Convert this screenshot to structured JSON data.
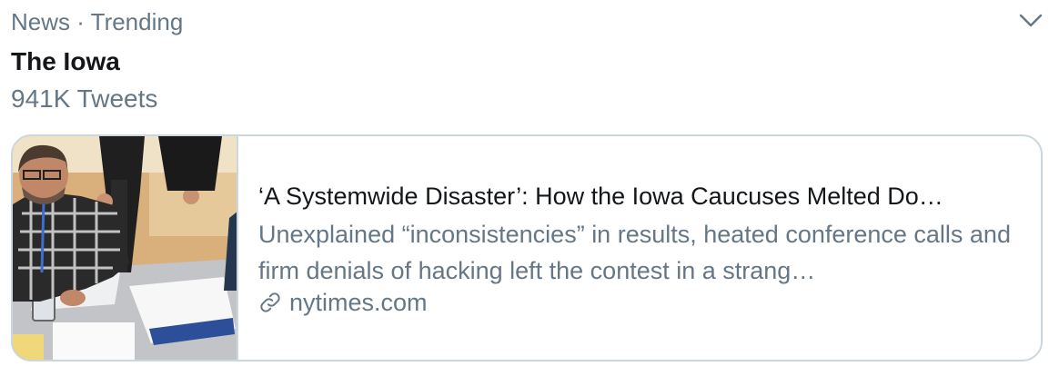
{
  "trend": {
    "meta": "News · Trending",
    "title": "The Iowa",
    "count": "941K Tweets",
    "menu_icon": "chevron-down-icon"
  },
  "card": {
    "headline": "‘A Systemwide Disaster’: How the Iowa Caucuses Melted Do…",
    "description": "Unexplained “inconsistencies” in results, heated conference calls and firm denials of hacking left the contest in a strang…",
    "domain": "nytimes.com",
    "link_icon": "link-icon",
    "image_alt": "Workers counting caucus results at a table"
  },
  "colors": {
    "primary_text": "#14171a",
    "secondary_text": "#657786",
    "border": "#ccd6dd"
  }
}
